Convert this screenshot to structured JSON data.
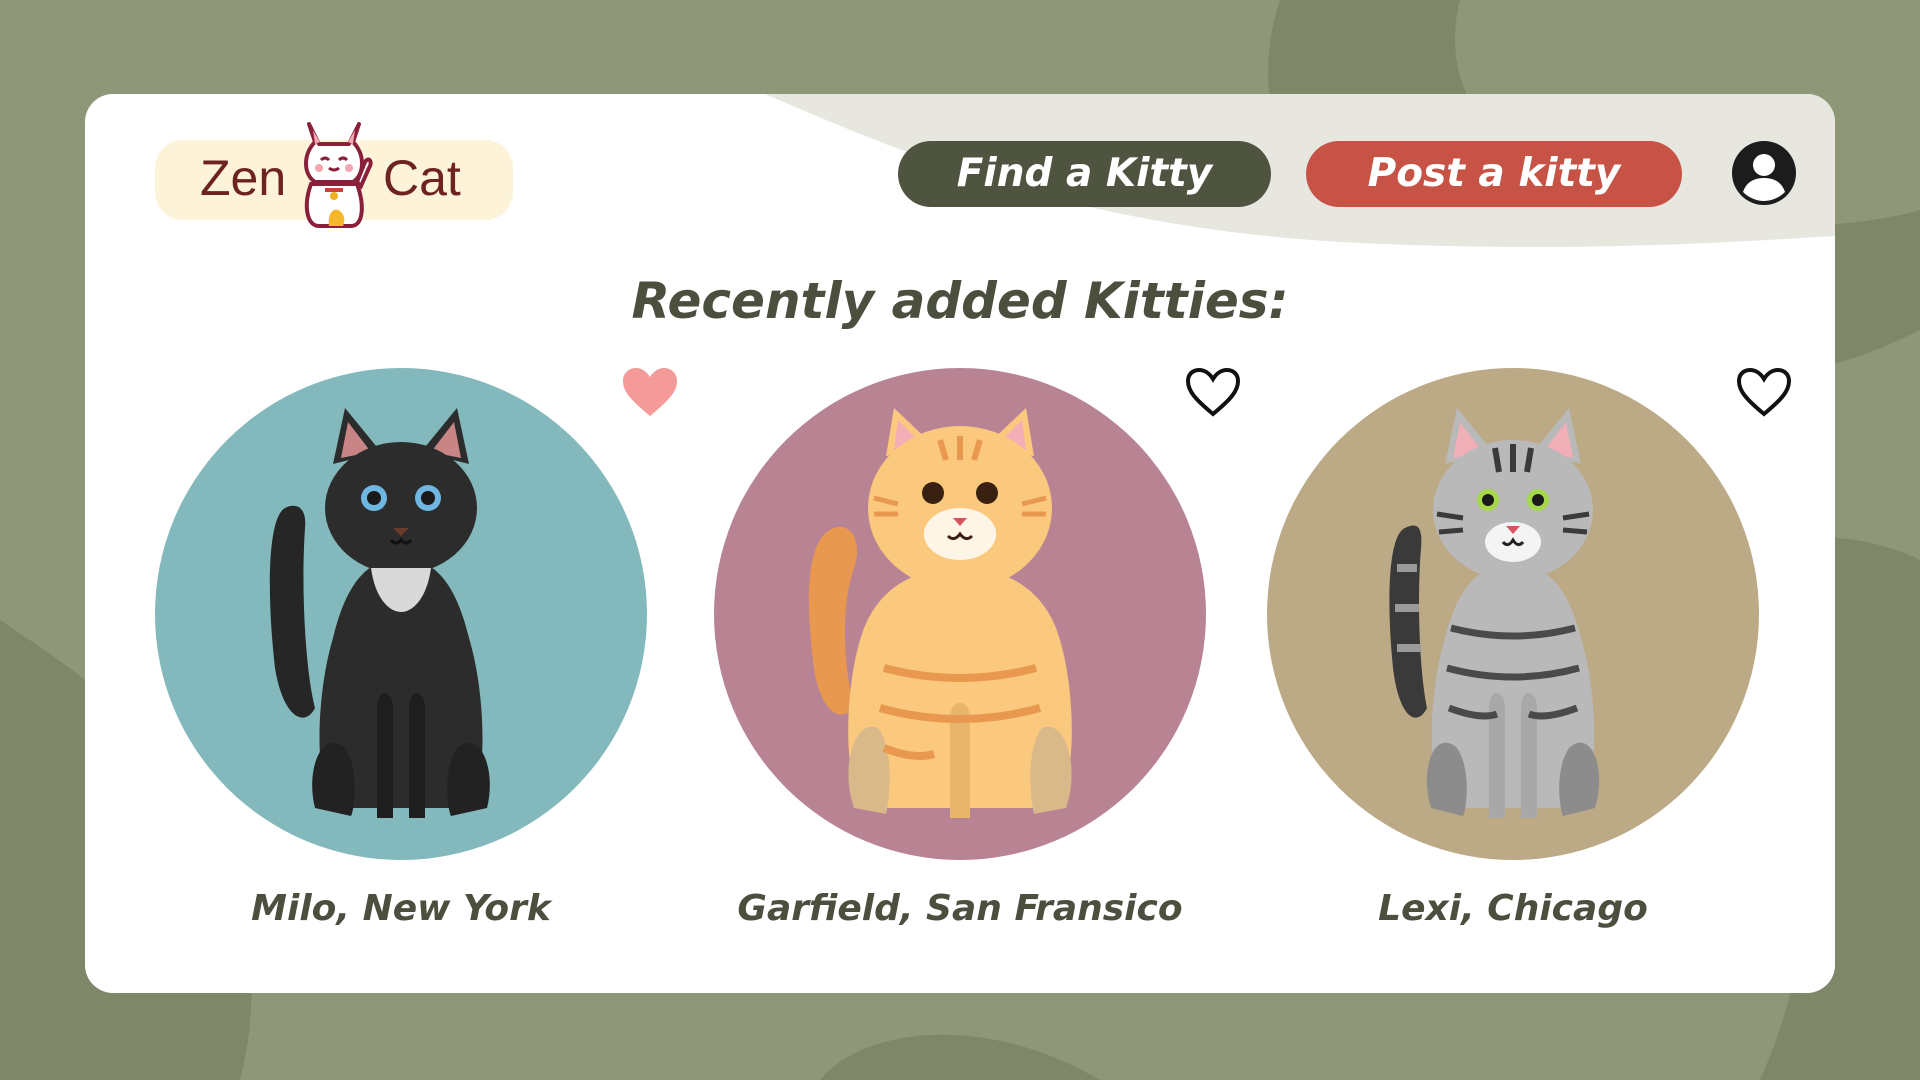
{
  "brand": {
    "word_left": "Zen",
    "word_right": "Cat"
  },
  "nav": {
    "find_label": "Find a Kitty",
    "post_label": "Post a kitty",
    "profile_icon": "user-circle-icon"
  },
  "section": {
    "heading": "Recently added Kitties:"
  },
  "kitties": [
    {
      "caption": "Milo, New York",
      "favorited": true,
      "circle_color": "#83b9bc",
      "fur": "black"
    },
    {
      "caption": "Garfield, San Fransico",
      "favorited": false,
      "circle_color": "#b88494",
      "fur": "orange-tabby"
    },
    {
      "caption": "Lexi, Chicago",
      "favorited": false,
      "circle_color": "#bca985",
      "fur": "grey-tabby"
    }
  ],
  "colors": {
    "background": "#8e9878",
    "find_button": "#4f5441",
    "post_button": "#c75346",
    "heart_filled": "#f49a98",
    "text": "#4b4f3e"
  }
}
